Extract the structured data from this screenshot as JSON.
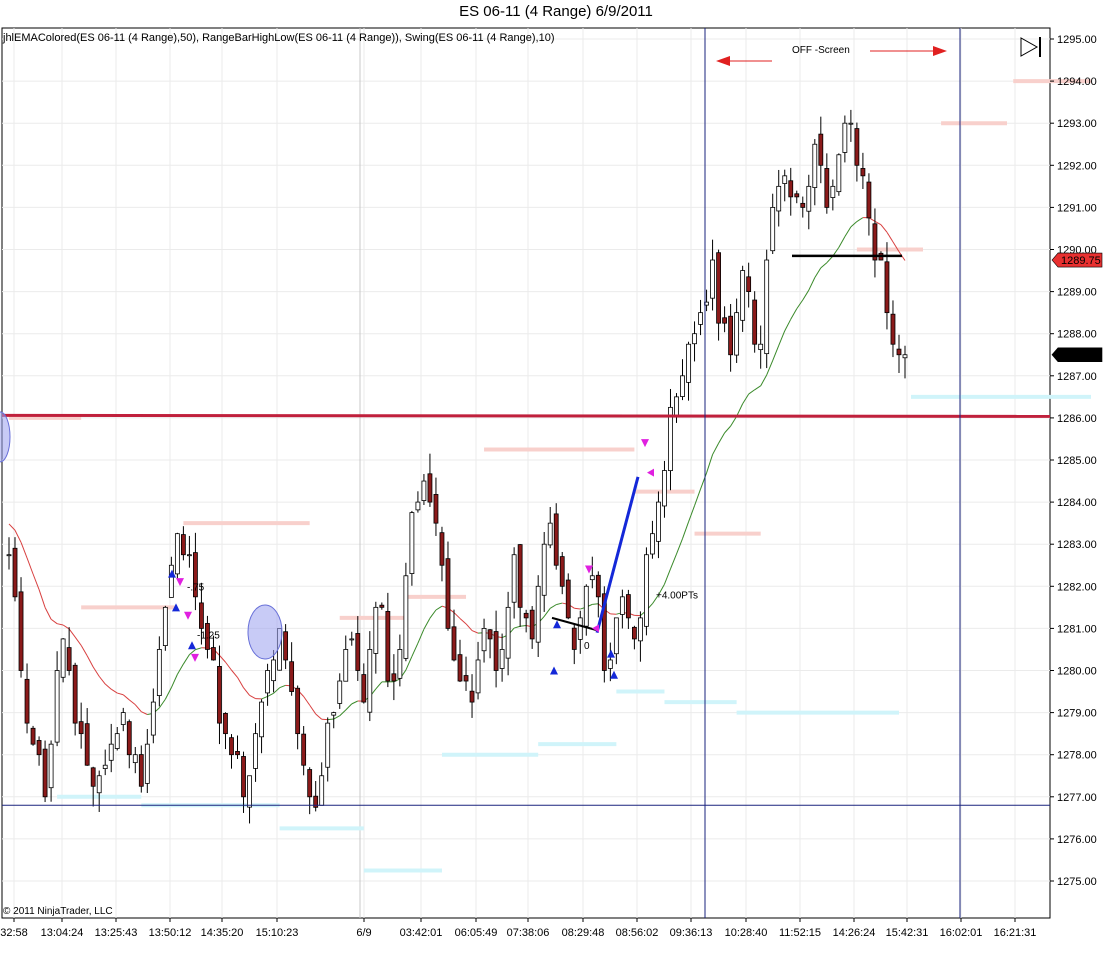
{
  "window": {
    "title": "ES 06-11 (4 Range)  6/9/2011"
  },
  "chart": {
    "indicator_label": "jhlEMAColored(ES 06-11 (4 Range),50), RangeBarHighLow(ES 06-11 (4 Range)), Swing(ES 06-11 (4 Range),10)",
    "copyright": "© 2011 NinjaTrader, LLC",
    "off_screen_label": "OFF -Screen",
    "icon": "skip-to-end-icon",
    "colors": {
      "up_bar": "#ffffff",
      "down_bar": "#8b1a1a",
      "wick": "#000000",
      "ema_up": "#3a8a2a",
      "ema_down": "#d84040",
      "resistance": "#f8d0cc",
      "support": "#d0f4fa",
      "horizontal_line": "#c0203c",
      "vertical_line": "#1a237e",
      "price_marker_red": "#e83030",
      "price_marker_black": "#000000"
    }
  },
  "chart_data": {
    "type": "candlestick",
    "title": "ES 06-11 (4 Range)  6/9/2011",
    "x_tick_labels": [
      "32:58",
      "13:04:24",
      "13:25:43",
      "13:50:12",
      "14:35:20",
      "15:10:23",
      "6/9",
      "03:42:01",
      "06:05:49",
      "07:38:06",
      "08:29:48",
      "08:56:02",
      "09:36:13",
      "10:28:40",
      "11:52:15",
      "14:26:24",
      "15:42:31",
      "16:02:01",
      "16:21:31"
    ],
    "y_tick_labels": [
      "1275.00",
      "1276.00",
      "1277.00",
      "1278.00",
      "1279.00",
      "1280.00",
      "1281.00",
      "1282.00",
      "1283.00",
      "1284.00",
      "1285.00",
      "1286.00",
      "1287.00",
      "1288.00",
      "1289.00",
      "1290.00",
      "1291.00",
      "1292.00",
      "1293.00",
      "1294.00",
      "1295.00"
    ],
    "ylim": [
      1274.25,
      1295.25
    ],
    "grid": true,
    "current_price_red": "1289.75",
    "current_price_black": "1287.50",
    "horizontal_price_lines": [
      1286.06,
      1276.8
    ],
    "annotations": [
      {
        "text": "-.75",
        "price": 1282.0
      },
      {
        "text": "-1.25",
        "price": 1280.85
      },
      {
        "text": "0",
        "price": 1280.6
      },
      {
        "text": "+4.00PTs",
        "price": 1281.8
      }
    ],
    "bar_count": 150,
    "swing_points_close": [
      [
        0,
        1282.6
      ],
      [
        3,
        1279.5
      ],
      [
        5,
        1278.3
      ],
      [
        7,
        1277.2
      ],
      [
        11,
        1281.2
      ],
      [
        13,
        1278.5
      ],
      [
        17,
        1277.2
      ],
      [
        22,
        1278.8
      ],
      [
        26,
        1277.5
      ],
      [
        29,
        1279.8
      ],
      [
        33,
        1283.2
      ],
      [
        37,
        1282.0
      ],
      [
        40,
        1280.2
      ],
      [
        43,
        1278.2
      ],
      [
        47,
        1277.0
      ],
      [
        50,
        1279.2
      ],
      [
        53,
        1280.9
      ],
      [
        57,
        1278.5
      ],
      [
        60,
        1276.5
      ],
      [
        63,
        1278.8
      ],
      [
        67,
        1280.8
      ],
      [
        70,
        1279.5
      ],
      [
        73,
        1281.6
      ],
      [
        76,
        1279.4
      ],
      [
        79,
        1283.0
      ],
      [
        82,
        1284.9
      ],
      [
        85,
        1282.8
      ],
      [
        88,
        1280.6
      ],
      [
        91,
        1279.0
      ],
      [
        94,
        1281.0
      ],
      [
        97,
        1280.2
      ],
      [
        100,
        1282.5
      ],
      [
        103,
        1280.2
      ],
      [
        106,
        1283.7
      ],
      [
        109,
        1282.0
      ],
      [
        112,
        1280.4
      ],
      [
        115,
        1282.5
      ],
      [
        118,
        1280.0
      ],
      [
        121,
        1281.8
      ],
      [
        124,
        1280.8
      ],
      [
        127,
        1283.4
      ],
      [
        130,
        1285.6
      ],
      [
        133,
        1286.6
      ],
      [
        136,
        1288.4
      ],
      [
        139,
        1289.2
      ],
      [
        142,
        1287.6
      ],
      [
        145,
        1289.4
      ],
      [
        148,
        1287.0
      ],
      [
        150,
        1290.6
      ],
      [
        153,
        1292.1
      ],
      [
        156,
        1290.8
      ],
      [
        159,
        1292.5
      ],
      [
        162,
        1290.6
      ],
      [
        165,
        1293.2
      ],
      [
        168,
        1292.0
      ],
      [
        171,
        1290.2
      ],
      [
        174,
        1288.2
      ],
      [
        177,
        1287.2
      ]
    ],
    "resistance_levels": [
      {
        "price": 1286.0,
        "from": 0,
        "to": 12
      },
      {
        "price": 1281.5,
        "from": 12,
        "to": 28
      },
      {
        "price": 1283.5,
        "from": 29,
        "to": 50
      },
      {
        "price": 1281.25,
        "from": 55,
        "to": 66
      },
      {
        "price": 1281.75,
        "from": 66,
        "to": 76
      },
      {
        "price": 1285.25,
        "from": 79,
        "to": 104
      },
      {
        "price": 1284.25,
        "from": 104,
        "to": 114
      },
      {
        "price": 1283.25,
        "from": 114,
        "to": 125
      },
      {
        "price": 1290.0,
        "from": 141,
        "to": 152
      },
      {
        "price": 1293.0,
        "from": 155,
        "to": 166
      },
      {
        "price": 1294.0,
        "from": 167,
        "to": 180
      }
    ],
    "support_levels": [
      {
        "price": 1277.0,
        "from": 8,
        "to": 22
      },
      {
        "price": 1276.8,
        "from": 22,
        "to": 45
      },
      {
        "price": 1276.25,
        "from": 45,
        "to": 59
      },
      {
        "price": 1275.25,
        "from": 59,
        "to": 72
      },
      {
        "price": 1278.0,
        "from": 72,
        "to": 88
      },
      {
        "price": 1278.25,
        "from": 88,
        "to": 101
      },
      {
        "price": 1279.5,
        "from": 101,
        "to": 109
      },
      {
        "price": 1279.25,
        "from": 109,
        "to": 121
      },
      {
        "price": 1279.0,
        "from": 121,
        "to": 148
      },
      {
        "price": 1286.5,
        "from": 150,
        "to": 180
      }
    ]
  }
}
